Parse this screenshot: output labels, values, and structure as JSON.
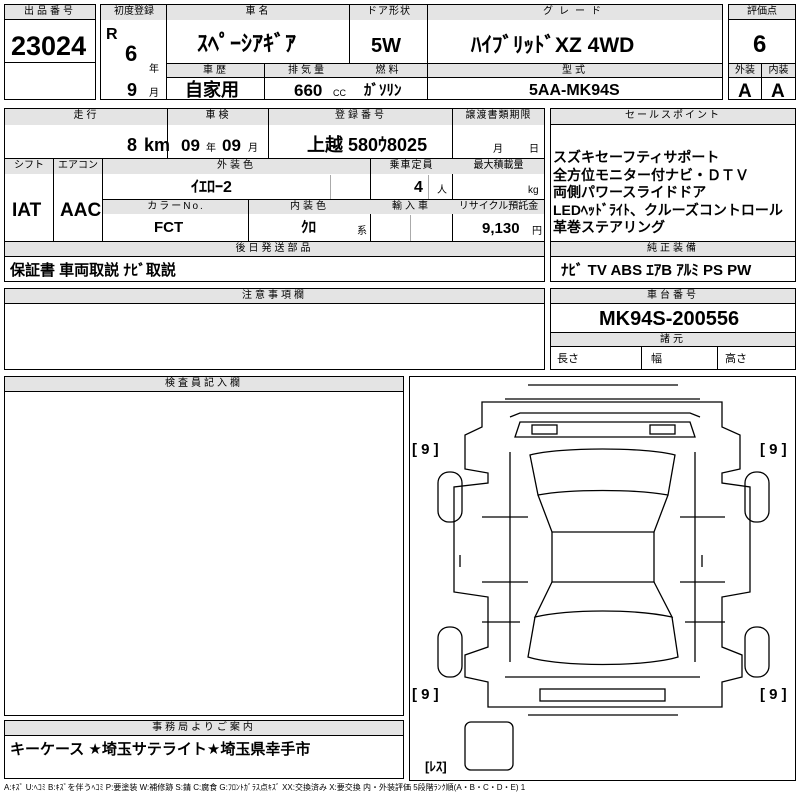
{
  "lot": {
    "label": "出品番号",
    "value": "23024"
  },
  "first_reg": {
    "label": "初度登録",
    "era": "R",
    "year": "6",
    "year_unit": "年",
    "month": "9",
    "month_unit": "月"
  },
  "car_name": {
    "label": "車名",
    "value": "ｽﾍﾟｰｼｱｷﾞｱ"
  },
  "door": {
    "label": "ドア形状",
    "value": "5W"
  },
  "grade": {
    "label": "グレード",
    "value": "ﾊｲﾌﾞﾘｯﾄﾞXZ 4WD"
  },
  "score": {
    "label": "評価点",
    "value": "6"
  },
  "history": {
    "label": "車歴",
    "value": "自家用"
  },
  "displacement": {
    "label": "排気量",
    "value": "660",
    "unit": "CC"
  },
  "fuel": {
    "label": "燃料",
    "value": "ｶﾞｿﾘﾝ"
  },
  "model": {
    "label": "型式",
    "value": "5AA-MK94S"
  },
  "exterior_grade": {
    "label": "外装",
    "value": "A"
  },
  "interior_grade": {
    "label": "内装",
    "value": "A"
  },
  "mileage": {
    "label": "走行",
    "value": "8",
    "unit": "km"
  },
  "inspection": {
    "label": "車検",
    "year": "09",
    "year_unit": "年",
    "month": "09",
    "month_unit": "月"
  },
  "registration": {
    "label": "登録番号",
    "value": "上越 580ｳ8025"
  },
  "transfer_docs": {
    "label": "譲渡書類期限",
    "month_unit": "月",
    "day_unit": "日"
  },
  "sales_points": {
    "label": "セールスポイント",
    "lines": [
      "スズキセーフティサポート",
      "全方位モニター付ナビ・ＤＴＶ",
      "両側パワースライドドア",
      "LEDﾍｯﾄﾞﾗｲﾄ、クルーズコントロール",
      "革巻ステアリング"
    ]
  },
  "shift": {
    "label": "シフト",
    "value": "IAT"
  },
  "aircon": {
    "label": "エアコン",
    "value": "AAC"
  },
  "ext_color": {
    "label": "外装色",
    "value": "ｲｴﾛｰ2"
  },
  "capacity": {
    "label": "乗車定員",
    "value": "4",
    "unit": "人"
  },
  "max_load": {
    "label": "最大積載量",
    "unit": "kg"
  },
  "color_no": {
    "label": "カラーNo.",
    "value": "FCT"
  },
  "int_color": {
    "label": "内装色",
    "value": "ｸﾛ",
    "unit": "系"
  },
  "import": {
    "label": "輸入車"
  },
  "recycle": {
    "label": "リサイクル預託金",
    "value": "9,130",
    "unit": "円"
  },
  "later_parts": {
    "label": "後日発送部品",
    "value": "保証書 車両取説 ﾅﾋﾞ取説"
  },
  "equipment": {
    "label": "純正装備",
    "value": "ﾅﾋﾞ TV ABS ｴｱB ｱﾙﾐ PS PW"
  },
  "notes": {
    "label": "注意事項欄"
  },
  "chassis": {
    "label": "車台番号",
    "value": "MK94S-200556"
  },
  "specs": {
    "label": "諸元",
    "length": "長さ",
    "width": "幅",
    "height": "高さ"
  },
  "inspector": {
    "label": "検査員記入欄"
  },
  "diagram": {
    "tire_fl": "[ 9 ]",
    "tire_fr": "[ 9 ]",
    "tire_rl": "[ 9 ]",
    "tire_rr": "[ 9 ]",
    "spare": "[ﾚｽ]"
  },
  "office": {
    "label": "事務局よりご案内",
    "value": "キーケース ★埼玉サテライト★埼玉県幸手市"
  },
  "legend": "A:ｷｽﾞ U:ﾍｺﾐ B:ｷｽﾞを伴うﾍｺﾐ P:要塗装 W:補修跡 S:錆 C:腐食 G:ﾌﾛﾝﾄｶﾞﾗｽ点ｷｽﾞ XX:交換済み X:要交換 内・外装評価 5段階ﾗﾝｸ順(A・B・C・D・E) 1"
}
